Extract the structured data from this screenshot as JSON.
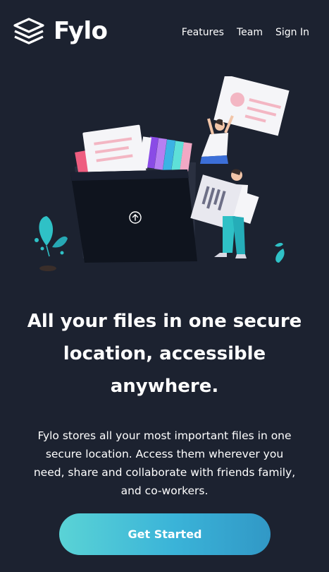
{
  "brand": {
    "name": "Fylo",
    "icon": "stacked-layers-logo",
    "colors": {
      "background": "#1c2230",
      "accent_start": "#5ad3d6",
      "accent_end": "#3198c6",
      "text": "#ffffff"
    }
  },
  "nav": {
    "links": [
      {
        "label": "Features"
      },
      {
        "label": "Team"
      },
      {
        "label": "Sign In"
      }
    ]
  },
  "hero": {
    "illustration": "person-organizing-files-into-folder",
    "upload_icon": "upload-arrow-icon",
    "headline_lines": [
      "All your files in one secure",
      "location, accessible",
      "anywhere."
    ],
    "description_lines": [
      "Fylo stores all your most important files in one",
      "secure location. Access them wherever you",
      "need, share and collaborate with friends family,",
      "and co-workers."
    ],
    "cta_label": "Get Started"
  }
}
